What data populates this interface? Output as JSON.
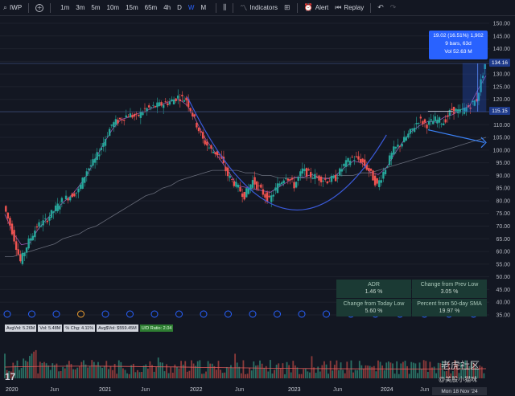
{
  "toolbar": {
    "symbol": "IWP",
    "timeframes": [
      "1m",
      "3m",
      "5m",
      "10m",
      "15m",
      "65m",
      "4h",
      "D",
      "W",
      "M"
    ],
    "active_timeframe": "W",
    "indicators_label": "Indicators",
    "alert_label": "Alert",
    "replay_label": "Replay"
  },
  "info_box": {
    "line1": "19.02 (16.51%) 1,902",
    "line2": "9 bars, 63d",
    "line3": "Vol 52.63 M"
  },
  "price_tags": {
    "upper": "134.16",
    "lower": "115.15"
  },
  "y_axis": {
    "ticks": [
      "150.00",
      "145.00",
      "140.00",
      "135.00",
      "130.00",
      "125.00",
      "120.00",
      "115.00",
      "110.00",
      "105.00",
      "100.00",
      "95.00",
      "90.00",
      "85.00",
      "80.00",
      "75.00",
      "70.00",
      "65.00",
      "60.00",
      "55.00",
      "50.00",
      "45.00",
      "40.00",
      "35.00"
    ]
  },
  "x_axis": {
    "labels": [
      "2020",
      "Jun",
      "2021",
      "Jun",
      "2022",
      "Jun",
      "2023",
      "Jun",
      "2024",
      "Jun",
      "Mon 18 Nov '24"
    ]
  },
  "stats": {
    "adr_label": "ADR",
    "adr_value": "1.46 %",
    "change_prev_low_label": "Change from Prev Low",
    "change_prev_low_value": "3.05 %",
    "change_today_low_label": "Change from Today Low",
    "change_today_low_value": "5.60 %",
    "sma50_label": "Percent from 50-day SMA",
    "sma50_value": "19.97 %"
  },
  "volume_legend": {
    "avg_vol": "AvgVol: 5.26M",
    "vol": "Vol: 5.48M",
    "pct_chg": "% Chg: 4.11%",
    "avg_dollar_vol": "Avg$Vol: $559.45M",
    "ud_ratio": "U/D Ratio: 2.04"
  },
  "tv_logo": "17",
  "watermark": {
    "line1": "老虎社区",
    "line2": "@美股小猫咪"
  },
  "colors": {
    "background": "#131722",
    "up": "#26a69a",
    "down": "#ef5350",
    "accent": "#2962ff"
  },
  "chart_data": {
    "type": "candlestick",
    "x": [
      "2020-01",
      "2020-02",
      "2020-03",
      "2020-04",
      "2020-05",
      "2020-06",
      "2020-07",
      "2020-08",
      "2020-09",
      "2020-10",
      "2020-11",
      "2020-12",
      "2021-01",
      "2021-02",
      "2021-03",
      "2021-04",
      "2021-05",
      "2021-06",
      "2021-07",
      "2021-08",
      "2021-09",
      "2021-10",
      "2021-11",
      "2021-12",
      "2022-01",
      "2022-02",
      "2022-03",
      "2022-04",
      "2022-05",
      "2022-06",
      "2022-07",
      "2022-08",
      "2022-09",
      "2022-10",
      "2022-11",
      "2022-12",
      "2023-01",
      "2023-02",
      "2023-03",
      "2023-04",
      "2023-05",
      "2023-06",
      "2023-07",
      "2023-08",
      "2023-09",
      "2023-10",
      "2023-11",
      "2023-12",
      "2024-01",
      "2024-02",
      "2024-03",
      "2024-04",
      "2024-05",
      "2024-06",
      "2024-07",
      "2024-08",
      "2024-09",
      "2024-10",
      "2024-11"
    ],
    "close": [
      78,
      68,
      56,
      64,
      70,
      72,
      76,
      80,
      82,
      84,
      92,
      96,
      103,
      110,
      112,
      114,
      113,
      116,
      117,
      118,
      119,
      121,
      120,
      112,
      104,
      100,
      98,
      90,
      86,
      82,
      88,
      84,
      80,
      86,
      90,
      86,
      92,
      90,
      89,
      88,
      89,
      94,
      97,
      96,
      92,
      86,
      93,
      100,
      103,
      107,
      112,
      110,
      112,
      111,
      116,
      115,
      117,
      120,
      134
    ],
    "sma_long": [
      58,
      58,
      59,
      60,
      61,
      62,
      63,
      65,
      66,
      67,
      69,
      70,
      72,
      74,
      76,
      78,
      80,
      82,
      83,
      85,
      86,
      88,
      89,
      90,
      91,
      92,
      92,
      92,
      92,
      91,
      91,
      90,
      90,
      89,
      89,
      89,
      89,
      89,
      89,
      89,
      90,
      90,
      90,
      91,
      91,
      92,
      93,
      94,
      95,
      96,
      97,
      98,
      99,
      100,
      101,
      102,
      103,
      104,
      105
    ],
    "y_range": [
      35,
      150
    ]
  }
}
